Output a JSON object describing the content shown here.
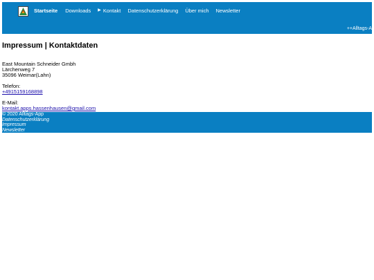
{
  "nav": {
    "items": [
      {
        "label": "Startseite"
      },
      {
        "label": "Downloads"
      },
      {
        "label": "Kontakt"
      },
      {
        "label": "Datenschutzerklärung"
      },
      {
        "label": "Über mich"
      },
      {
        "label": "Newsletter"
      }
    ]
  },
  "ticker": "++Alltags-A",
  "page": {
    "title": "Impressum | Kontaktdaten",
    "company": "East Mountain Schneider Gmbh",
    "street": "Lärchenweg 7",
    "city": "35096 Weimar(Lahn)",
    "phone_label": "Telefon:",
    "phone": "+4915159168898",
    "email_label": "E-Mail:",
    "email": "kontakt.apps.hassenhausen@gmail.com"
  },
  "footer": {
    "copyright": "© 2020 Alltags-App",
    "links": [
      "Datenschutzerklärung",
      "Impressum",
      "Newsletter"
    ]
  },
  "colors": {
    "brand": "#0a7fc2"
  }
}
